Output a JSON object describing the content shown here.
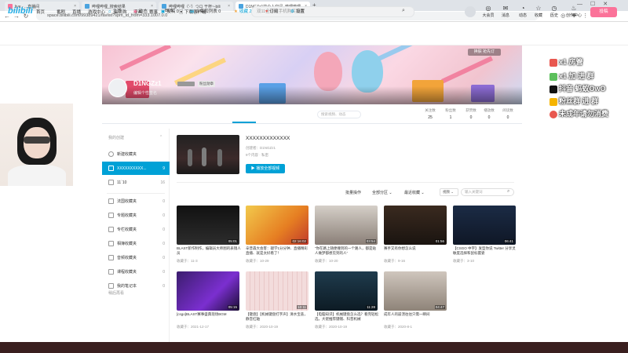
{
  "browser": {
    "tabs": [
      {
        "label": "live - ...直播间",
        "active": false
      },
      {
        "label": "哔哩哔哩_搜索结果",
        "active": false
      },
      {
        "label": "哔哩哔哩（'-'）つロ 干杯~-bili",
        "active": false
      },
      {
        "label": "D1NGZz1的个人空间_哔哩哔哩",
        "active": true
      }
    ],
    "new_tab": "+",
    "url": "space.bilibili.com/99389421/favlist?spm_id_from=333.1007.0.0",
    "back": "←",
    "forward": "→",
    "reload": "↻"
  },
  "header": {
    "logo": "bilibili",
    "nav": [
      "首页",
      "番剧",
      "直播",
      "游戏中心",
      "会员购",
      "漫画",
      "赛事",
      "BLS",
      "下载客户端"
    ],
    "search_placeholder": "双11全价位手机购买指南",
    "icons": [
      {
        "name": "big-member",
        "label": "大会员",
        "glyph": "◎"
      },
      {
        "name": "message",
        "label": "消息",
        "glyph": "✉"
      },
      {
        "name": "dynamic",
        "label": "动态",
        "glyph": "◔"
      },
      {
        "name": "favorite",
        "label": "收藏",
        "glyph": "☆"
      },
      {
        "name": "history",
        "label": "历史",
        "glyph": "◷"
      },
      {
        "name": "creation",
        "label": "创作中心",
        "glyph": "♨"
      }
    ],
    "upload": "投稿"
  },
  "banner": {
    "username": "D1NGZz1",
    "sign": "编辑个性签名",
    "fan_badge": "粉丝勋章",
    "skin_button": "换肤  抢先订"
  },
  "space_nav": {
    "items": [
      {
        "label": "主页",
        "icon": "⌂"
      },
      {
        "label": "动态",
        "icon": "◉"
      },
      {
        "label": "投稿 0",
        "icon": "▣"
      },
      {
        "label": "合集和列表 0",
        "icon": "▤"
      },
      {
        "label": "收藏 2",
        "icon": "★"
      },
      {
        "label": "订阅",
        "icon": "♥"
      },
      {
        "label": "设置",
        "icon": "⚙"
      }
    ],
    "search_placeholder": "搜索视频、动态",
    "stats": [
      {
        "label": "关注数",
        "value": "25"
      },
      {
        "label": "粉丝数",
        "value": "1"
      },
      {
        "label": "获赞数",
        "value": "0"
      },
      {
        "label": "播放数",
        "value": "0"
      },
      {
        "label": "阅读数",
        "value": "0"
      }
    ]
  },
  "sidebar": {
    "heading": "我的创建",
    "create_label": "新建收藏夹",
    "folders": [
      {
        "label": "XXXXXXXXXX...",
        "count": "9",
        "active": true
      },
      {
        "label": "11`10",
        "count": "16",
        "active": false
      }
    ],
    "collected_heading": "",
    "collected": [
      {
        "label": "法国收藏夹",
        "count": "0"
      },
      {
        "label": "专题收藏夹",
        "count": "0"
      },
      {
        "label": "专栏收藏夹",
        "count": "0"
      },
      {
        "label": "相簿收藏夹",
        "count": "0"
      },
      {
        "label": "音频收藏夹",
        "count": "0"
      },
      {
        "label": "课程收藏夹",
        "count": "0"
      },
      {
        "label": "我的笔记本",
        "count": "0"
      }
    ],
    "footer": "稍后再看"
  },
  "favorite": {
    "title": "XXXXXXXXXXXXX",
    "creator": "创建者：D1NGZz1",
    "meta": "9个内容 · 私密",
    "play_all": "播放全部视频"
  },
  "filters": {
    "batch": "批量操作",
    "all_partition": "全部分区 ⌄",
    "recent": "最近收藏 ⌄",
    "select": "视频 ⌄",
    "search_placeholder": "输入关键词"
  },
  "cards": [
    {
      "title": "BLAST新作制作，编辑员大师图的表镜人员",
      "date": "收藏于：11-3",
      "duration": "05:01"
    },
    {
      "title": "辛普森大会客：辍学1分分钟、直播精彩直播、就是太好看了！",
      "date": "收藏于：10-29",
      "duration": "02:16:02"
    },
    {
      "title": "“你在路上随便撞到的一个路人，都是贴人做梦都想见到的人”",
      "date": "收藏于：10-20",
      "duration": "03:54"
    },
    {
      "title": "赛手又有你想怎么说",
      "date": "收藏于：9-16",
      "duration": "01:56"
    },
    {
      "title": "【CSGO 中字】发型你说 Twitter 分享灵敏度选择和鼠标握姿",
      "date": "收藏于：3-10",
      "duration": "06:41"
    },
    {
      "title": "[csgo]BLAST赛事盛典现场BGM",
      "date": "收藏于：2021-12-17",
      "duration": "05:15"
    },
    {
      "title": "【键盘】【机械键盘打字声】清水宝盖，静音红轴",
      "date": "收藏于：2020-10-19",
      "duration": "10:11"
    },
    {
      "title": "【电脑知识】机械键盘怎么选？看完轻松选，大佬推荐键帽、科普机械",
      "date": "收藏于：2020-10-19",
      "duration": "11:28"
    },
    {
      "title": "成年人的崩溃往往只需一瞬间",
      "date": "收藏于：2020-8-1",
      "duration": "04:47"
    }
  ],
  "overlay": [
    {
      "text": "x1 房管",
      "color": "#e8574f"
    },
    {
      "text": "x1 加  进  群",
      "color": "#5bbf5b"
    },
    {
      "text": "抖音 蚂蚁OwO",
      "color": "#111111"
    },
    {
      "text": "粉丝群  进  群",
      "color": "#f5b400"
    },
    {
      "text": "未成年请勿消费",
      "color": "#e8574f"
    }
  ]
}
